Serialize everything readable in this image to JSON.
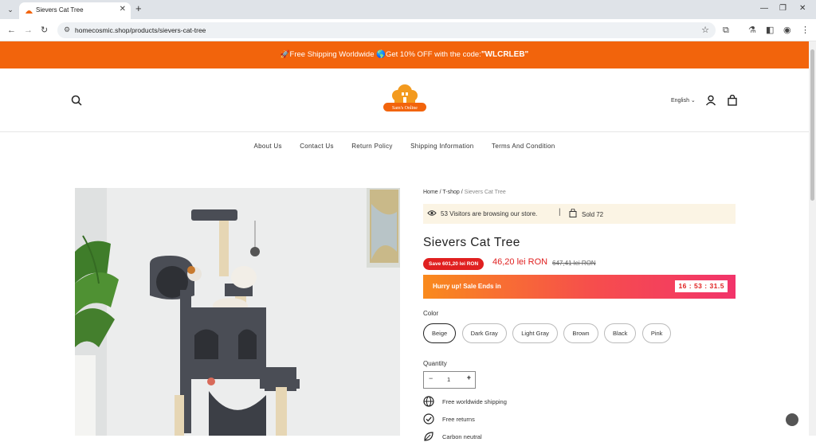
{
  "browser": {
    "tab_title": "Sievers Cat Tree",
    "url": "homecosmic.shop/products/sievers-cat-tree"
  },
  "banner": {
    "prefix": "🚀Free Shipping Worldwide 🌎Get 10% OFF with the code:",
    "code": "\"WLCRLEB\""
  },
  "header": {
    "logo_text": "Sam's Online",
    "language": "English"
  },
  "nav": {
    "items": [
      "About Us",
      "Contact Us",
      "Return Policy",
      "Shipping Information",
      "Terms And Condition"
    ]
  },
  "product": {
    "breadcrumb": {
      "home": "Home",
      "sep1": " / ",
      "shop": "T-shop",
      "sep2": " / ",
      "current": "Sievers Cat Tree"
    },
    "visitors_text": "53 Visitors are browsing our store.",
    "separator": "|",
    "sold_text": "Sold 72",
    "title": "Sievers Cat Tree",
    "save_badge": "Save 601,20 lei RON",
    "price": "46,20 lei RON",
    "old_price": "647,41 lei RON",
    "sale_text": "Hurry up! Sale Ends in",
    "countdown": "16 : 53 : 31.5",
    "color_label": "Color",
    "colors": [
      "Beige",
      "Dark Gray",
      "Light Gray",
      "Brown",
      "Black",
      "Pink"
    ],
    "selected_color": "Beige",
    "quantity_label": "Quantity",
    "quantity": "1",
    "minus": "−",
    "plus": "+",
    "features": [
      "Free worldwide shipping",
      "Free returns",
      "Carbon neutral"
    ]
  },
  "colors": {
    "banner": "#f2640c",
    "sale": "#e02020"
  }
}
